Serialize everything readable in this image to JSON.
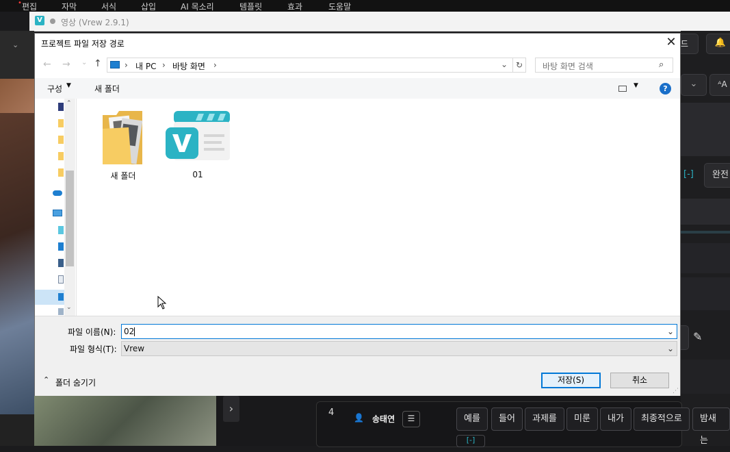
{
  "app": {
    "menu": [
      "편집",
      "자막",
      "서식",
      "삽입",
      "AI 목소리",
      "템플릿",
      "효과",
      "도움말"
    ],
    "window_title": "영상 (Vrew 2.9.1)",
    "right_buttons": [
      "이드",
      "완전"
    ],
    "bracket_label": "[-]",
    "arrow_label": "›",
    "row_number": "4",
    "speaker_name": "송태연",
    "word_chips": [
      "예를",
      "들어",
      "과제를",
      "미룬",
      "내가",
      "최종적으로",
      "밤새는"
    ],
    "bottom_bracket": "[-]"
  },
  "dialog": {
    "title": "프로젝트 파일 저장 경로",
    "breadcrumb": [
      "내 PC",
      "바탕 화면"
    ],
    "search_placeholder": "바탕 화면 검색",
    "organize_label": "구성",
    "new_folder_label": "새 폴더",
    "files": [
      {
        "name": "새 폴더",
        "type": "folder"
      },
      {
        "name": "01",
        "type": "vrew-file"
      }
    ],
    "filename_label": "파일 이름(N):",
    "filename_value": "02",
    "filetype_label": "파일 형식(T):",
    "filetype_value": "Vrew",
    "hide_folders_label": "폴더 숨기기",
    "save_label": "저장(S)",
    "cancel_label": "취소"
  },
  "colors": {
    "vrew_accent": "#2bb3c4",
    "folder_yellow": "#f7cc62",
    "windows_blue": "#0078d7",
    "help_blue": "#1a6fc9"
  }
}
